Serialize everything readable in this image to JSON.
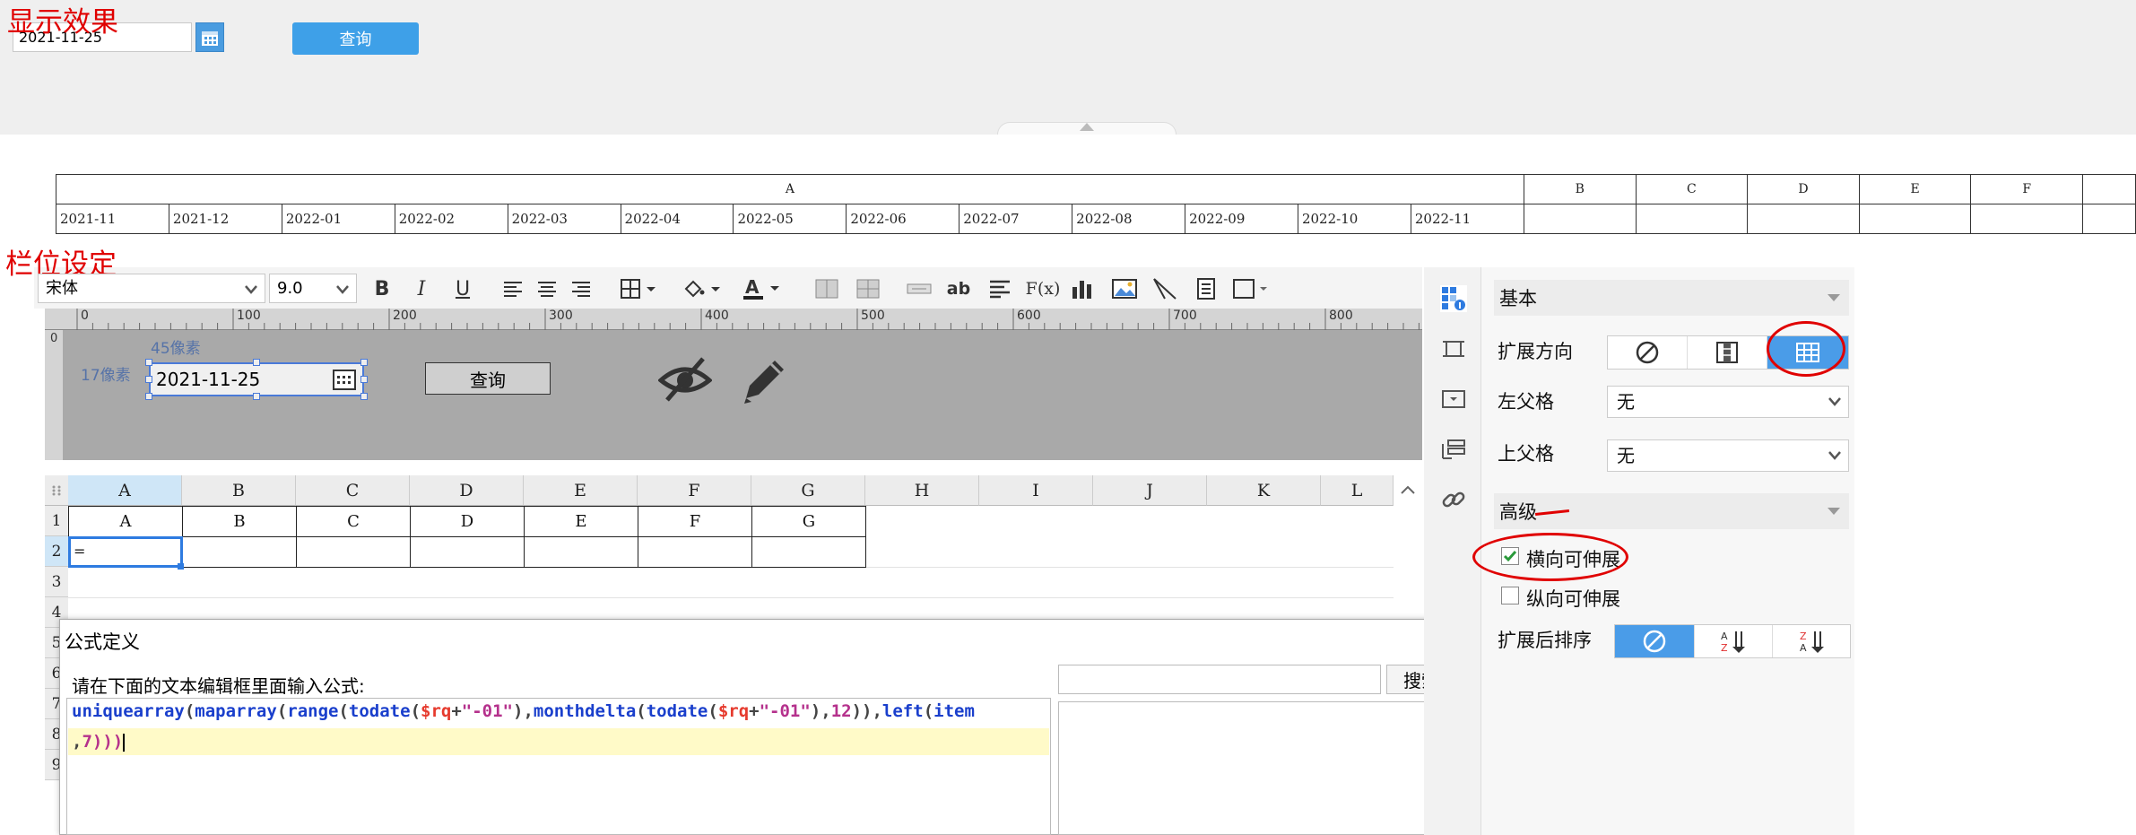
{
  "preview": {
    "label": "显示效果",
    "date_value": "2021-11-25",
    "query_label": "查询"
  },
  "result": {
    "header": [
      "A",
      "B",
      "C",
      "D",
      "E",
      "F"
    ],
    "months": [
      "2021-11",
      "2021-12",
      "2022-01",
      "2022-02",
      "2022-03",
      "2022-04",
      "2022-05",
      "2022-06",
      "2022-07",
      "2022-08",
      "2022-09",
      "2022-10",
      "2022-11"
    ]
  },
  "designer": {
    "label": "栏位设定",
    "toolbar": {
      "font": "宋体",
      "size": "9.0",
      "bold": "B",
      "italic": "I",
      "underline": "U",
      "formula_icon": "F(x)",
      "ab": "ab"
    },
    "ruler": [
      "0",
      "100",
      "200",
      "300",
      "400",
      "500",
      "600",
      "700",
      "800"
    ],
    "canvas": {
      "height_label": "45像素",
      "left_label": "17像素",
      "date_value": "2021-11-25",
      "query_label": "查询"
    },
    "grid": {
      "columns": [
        "A",
        "B",
        "C",
        "D",
        "E",
        "F",
        "G",
        "H",
        "I",
        "J",
        "K",
        "L"
      ],
      "rows": [
        "1",
        "2",
        "3",
        "4",
        "5",
        "6",
        "7",
        "8",
        "9"
      ],
      "row1": [
        "A",
        "B",
        "C",
        "D",
        "E",
        "F",
        "G"
      ],
      "a2": "="
    }
  },
  "dialog": {
    "title": "公式定义",
    "hint": "请在下面的文本编辑框里面输入公式:",
    "search_label": "搜索",
    "code": {
      "l1": [
        {
          "t": "uniquearray",
          "c": "kw"
        },
        {
          "t": "(",
          "c": "pn"
        },
        {
          "t": "maparray",
          "c": "kw"
        },
        {
          "t": "(",
          "c": "pn"
        },
        {
          "t": "range",
          "c": "kw"
        },
        {
          "t": "(",
          "c": "pn"
        },
        {
          "t": "todate",
          "c": "kw"
        },
        {
          "t": "(",
          "c": "pn"
        },
        {
          "t": "$rq",
          "c": "vr"
        },
        {
          "t": "+",
          "c": "pn"
        },
        {
          "t": "\"-01\"",
          "c": "st"
        },
        {
          "t": "),",
          "c": "pn"
        },
        {
          "t": "monthdelta",
          "c": "kw"
        },
        {
          "t": "(",
          "c": "pn"
        },
        {
          "t": "todate",
          "c": "kw"
        },
        {
          "t": "(",
          "c": "pn"
        },
        {
          "t": "$rq",
          "c": "vr"
        },
        {
          "t": "+",
          "c": "pn"
        },
        {
          "t": "\"-01\"",
          "c": "st"
        },
        {
          "t": "),",
          "c": "pn"
        },
        {
          "t": "12",
          "c": "st"
        },
        {
          "t": ")),",
          "c": "pn"
        },
        {
          "t": "left",
          "c": "kw"
        },
        {
          "t": "(",
          "c": "pn"
        },
        {
          "t": "item",
          "c": "kw"
        }
      ],
      "l2": [
        {
          "t": ",",
          "c": "pn"
        },
        {
          "t": "7",
          "c": "st"
        },
        {
          "t": ")))",
          "c": "st"
        }
      ]
    }
  },
  "panel": {
    "basic": "基本",
    "expand_dir": "扩展方向",
    "left_parent": "左父格",
    "left_parent_val": "无",
    "top_parent": "上父格",
    "top_parent_val": "无",
    "advanced": "高级",
    "h_stretch": "横向可伸展",
    "v_stretch": "纵向可伸展",
    "sort_after": "扩展后排序"
  },
  "colors": {
    "annotation_red": "#e00000",
    "primary_blue": "#3ea0e8",
    "selected_blue": "#4a9ce8"
  }
}
